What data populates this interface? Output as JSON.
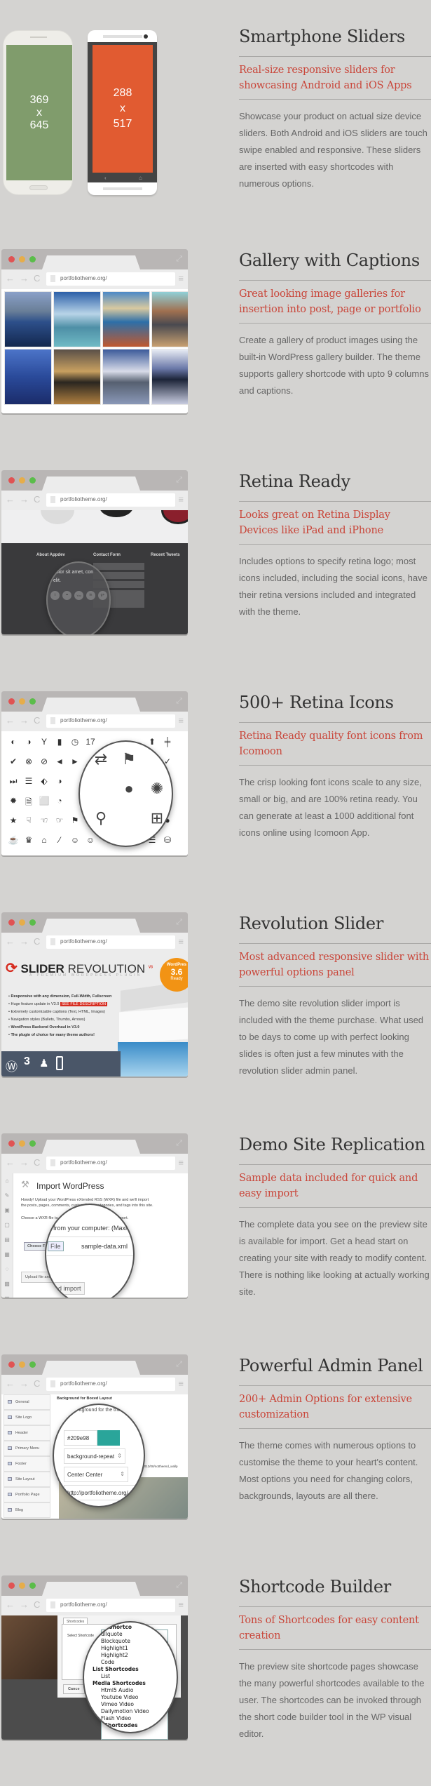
{
  "browser": {
    "url": "portfoliotheme.org/",
    "nav_back": "←",
    "nav_forward": "→",
    "nav_reload": "C",
    "menu_icon": "≡",
    "expand_icon": "⤢"
  },
  "features": [
    {
      "title": "Smartphone Sliders",
      "subtitle": "Real-size responsive sliders for showcasing Android and iOS Apps",
      "description": "Showcase your product on actual size device sliders. Both Android and iOS sliders are touch swipe enabled and responsive. These sliders are inserted with easy shortcodes with numerous options."
    },
    {
      "title": "Gallery with Captions",
      "subtitle": "Great looking image galleries for insertion into post, page or portfolio",
      "description": "Create a gallery of product images using the built-in WordPress gallery builder. The theme supports gallery shortcode with upto 9 columns and captions."
    },
    {
      "title": "Retina Ready",
      "subtitle": "Looks great on Retina Display Devices like iPad and iPhone",
      "description": "Includes options to specify retina logo; most icons included, including the social icons, have their retina versions included and integrated with the theme."
    },
    {
      "title": "500+ Retina Icons",
      "subtitle": "Retina Ready quality font icons from Icomoon",
      "description": "The crisp looking font icons scale to any size, small or big, and are 100% retina ready. You can generate at least a 1000 additional font icons online using Icomoon App."
    },
    {
      "title": "Revolution Slider",
      "subtitle": "Most advanced responsive slider with powerful options panel",
      "description": "The demo site revolution slider import is included with the theme purchase. What used to be days to come up with perfect looking slides is often just a few minutes with the revolution slider admin panel."
    },
    {
      "title": "Demo Site Replication",
      "subtitle": "Sample data included for quick and easy import",
      "description": "The complete data you see on the preview site is available for import. Get a head start on creating your site with ready to modify content. There is nothing like looking at actually working site."
    },
    {
      "title": "Powerful Admin Panel",
      "subtitle": "200+ Admin Options for extensive customization",
      "description": "The theme comes with numerous options to customise the theme to your heart's content. Most options you need for changing colors, backgrounds, layouts are all there."
    },
    {
      "title": "Shortcode Builder",
      "subtitle": "Tons of Shortcodes for easy content creation",
      "description": "The preview site shortcode pages showcase the many powerful shortcodes available to the user. The shortcodes can be invoked through the short code builder tool in the WP visual editor."
    }
  ],
  "phones": {
    "android": {
      "w": "369",
      "x": "x",
      "h": "645",
      "color": "#809c6c"
    },
    "iphone": {
      "w": "288",
      "x": "x",
      "h": "517",
      "color": "#e15b31"
    },
    "back_key": "‹",
    "home_key": "⌂"
  },
  "retina": {
    "col1": "About Appdev",
    "col2": "Contact Form",
    "col3": "Recent Tweets",
    "lens_text1": "dolor sit amet, con",
    "lens_text2": "elit.",
    "social_icons": [
      "twitter-icon",
      "flickr-icon",
      "youtube-icon",
      "linkedin-icon",
      "google-plus-icon"
    ],
    "social_glyphs": [
      "t",
      "••",
      "You",
      "in",
      "g+"
    ]
  },
  "icons": {
    "grid": [
      "◐",
      "◑",
      "Y",
      "▮",
      "◷",
      "17",
      "",
      "",
      "",
      "⬆",
      "╪",
      "✔",
      "⊗",
      "⊘",
      "◄",
      "►",
      "",
      "",
      "",
      "",
      "",
      "✓",
      "⏭",
      "☰",
      "⬖",
      "◑",
      "",
      "",
      "",
      "",
      "",
      "",
      "⌄",
      "✹",
      "🗎",
      "⬜",
      "◔",
      "",
      "",
      "",
      "",
      "",
      "",
      "♨",
      "★",
      "☟",
      "☜",
      "☞",
      "⚑",
      "",
      "",
      "",
      "",
      "",
      "●",
      "☕",
      "♛",
      "⌂",
      "⁄",
      "☺",
      "☺",
      "",
      "",
      "◔",
      "☰",
      "⛁"
    ],
    "lens": [
      "⇄",
      "⚑",
      "",
      "",
      "●",
      "✺",
      "⚲",
      "",
      "⊞"
    ]
  },
  "revslider": {
    "brand": "SLIDER",
    "brand2": "REVOLUTION",
    "version": "V3",
    "tagline": "A PREMIUM WORDPRESS PLUGIN",
    "bullets": [
      "Responsive with any dimension, Full-Width, Fullscreen",
      "Huge feature update in V3.0",
      "Extremely customizable captions (Text, HTML, Images)",
      "Navigation styles (Bullets, Thumbs, Arrows)",
      "WordPress Backend Overhaul in V3.0",
      "The plugin of choice for many theme authors!"
    ],
    "see_file_label": "SEE FILE DESCRIPTION",
    "badge_line1": "WordPres",
    "badge_line2": "3.6",
    "badge_line3": "Ready"
  },
  "import": {
    "title": "Import WordPress",
    "intro": "Howdy! Upload your WordPress eXtended RSS (WXR) file and we'll import the posts, pages, comments, custom fields, categories, and tags into this site.",
    "choose_text": "Choose a WXR file to upload, then click Upload file and import.",
    "choose_file_label": "Choose a file from your computer: (Maximum size)",
    "lens_from": "from your computer: (Maxim",
    "file_button": "File",
    "file_name": "sample-data.xml",
    "choose_button": "Choose F",
    "upload_button": "Upload file and import",
    "lens_upload": "and import"
  },
  "admin": {
    "menu": [
      "General",
      "Site Logo",
      "Header",
      "Primary Menu",
      "Footer",
      "Site Layout",
      "Portfolio Page",
      "Blog"
    ],
    "section_title": "Background for Boxed Layout",
    "lens_caption": "kground for the the",
    "color_value": "#209e98",
    "repeat_value": "background-repeat",
    "position_value": "Center Center",
    "url_value": "http://portfoliotheme.org/",
    "image_path": "/2013/08/nottheend_wallp",
    "accent": "#2aa59a"
  },
  "shortcodes": {
    "tab": "Shortcodes",
    "select_label": "Select Shortcode",
    "cancel": "Cance",
    "options": [
      {
        "label": "aphy Shortco",
        "group": true
      },
      {
        "label": "ullquote",
        "group": false
      },
      {
        "label": "Blockquote",
        "group": false
      },
      {
        "label": "Highlight1",
        "group": false
      },
      {
        "label": "Highlight2",
        "group": false
      },
      {
        "label": "Code",
        "group": false
      },
      {
        "label": "List Shortcodes",
        "group": true
      },
      {
        "label": "List",
        "group": false
      },
      {
        "label": "Media Shortcodes",
        "group": true
      },
      {
        "label": "Html5 Audio",
        "group": false
      },
      {
        "label": "Youtube Video",
        "group": false
      },
      {
        "label": "Vimeo Video",
        "group": false
      },
      {
        "label": "Dailymotion Video",
        "group": false
      },
      {
        "label": "Flash Video",
        "group": false
      },
      {
        "label": "der Shortcodes",
        "group": true
      }
    ]
  }
}
